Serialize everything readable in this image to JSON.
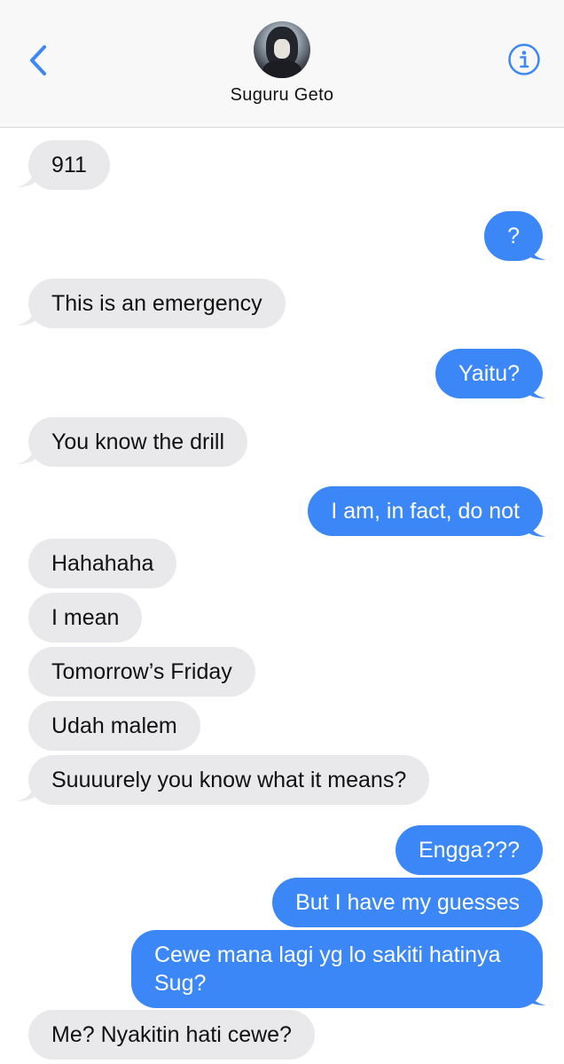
{
  "header": {
    "contact_name": "Suguru Geto",
    "back_icon": "chevron-left-icon",
    "info_icon": "info-icon",
    "accent_color": "#3b87f7"
  },
  "messages": [
    {
      "side": "received",
      "text": "911"
    },
    {
      "side": "sent",
      "text": "?"
    },
    {
      "side": "received",
      "text": "This is an emergency"
    },
    {
      "side": "sent",
      "text": "Yaitu?"
    },
    {
      "side": "received",
      "text": "You know the drill"
    },
    {
      "side": "sent",
      "text": "I am, in fact, do not"
    },
    {
      "side": "received",
      "text": "Hahahaha"
    },
    {
      "side": "received",
      "text": "I mean"
    },
    {
      "side": "received",
      "text": "Tomorrow’s Friday"
    },
    {
      "side": "received",
      "text": "Udah malem"
    },
    {
      "side": "received",
      "text": "Suuuurely you know what it means?"
    },
    {
      "side": "sent",
      "text": "Engga???"
    },
    {
      "side": "sent",
      "text": "But I have my guesses"
    },
    {
      "side": "sent",
      "text": "Cewe mana lagi yg lo sakiti hatinya Sug?"
    },
    {
      "side": "received",
      "text": "Me? Nyakitin hati cewe?"
    }
  ],
  "colors": {
    "sent_bubble": "#3b87f7",
    "received_bubble": "#e9e9eb",
    "header_bg": "#f8f8f9"
  }
}
